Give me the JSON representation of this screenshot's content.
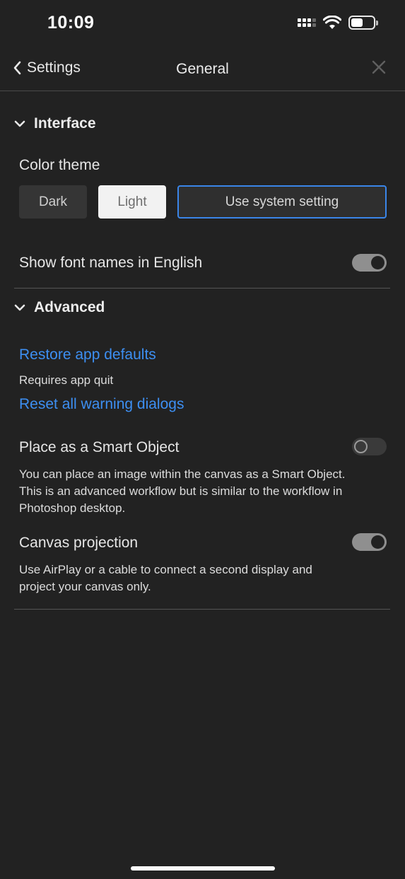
{
  "status_bar": {
    "time": "10:09"
  },
  "nav": {
    "back_label": "Settings",
    "title": "General"
  },
  "interface": {
    "heading": "Interface",
    "color_theme_label": "Color theme",
    "theme_options": [
      "Dark",
      "Light",
      "Use system setting"
    ],
    "selected_theme": "Use system setting",
    "font_names_label": "Show font names in English",
    "font_names_enabled": true
  },
  "advanced": {
    "heading": "Advanced",
    "restore_link": "Restore app defaults",
    "restore_note": "Requires app quit",
    "reset_link": "Reset all warning dialogs",
    "smart_object_label": "Place as a Smart Object",
    "smart_object_enabled": false,
    "smart_object_desc": "You can place an image within the canvas as a Smart Object. This is an advanced workflow but is similar to the workflow in Photoshop desktop.",
    "canvas_projection_label": "Canvas projection",
    "canvas_projection_enabled": true,
    "canvas_projection_desc": "Use AirPlay or a cable to connect a second display and project your canvas only."
  },
  "colors": {
    "accent": "#3d8ff2",
    "background": "#222222"
  },
  "icons": [
    "chevron-left-icon",
    "close-icon",
    "chevron-down-icon",
    "wifi-icon",
    "battery-icon",
    "signal-icon"
  ]
}
